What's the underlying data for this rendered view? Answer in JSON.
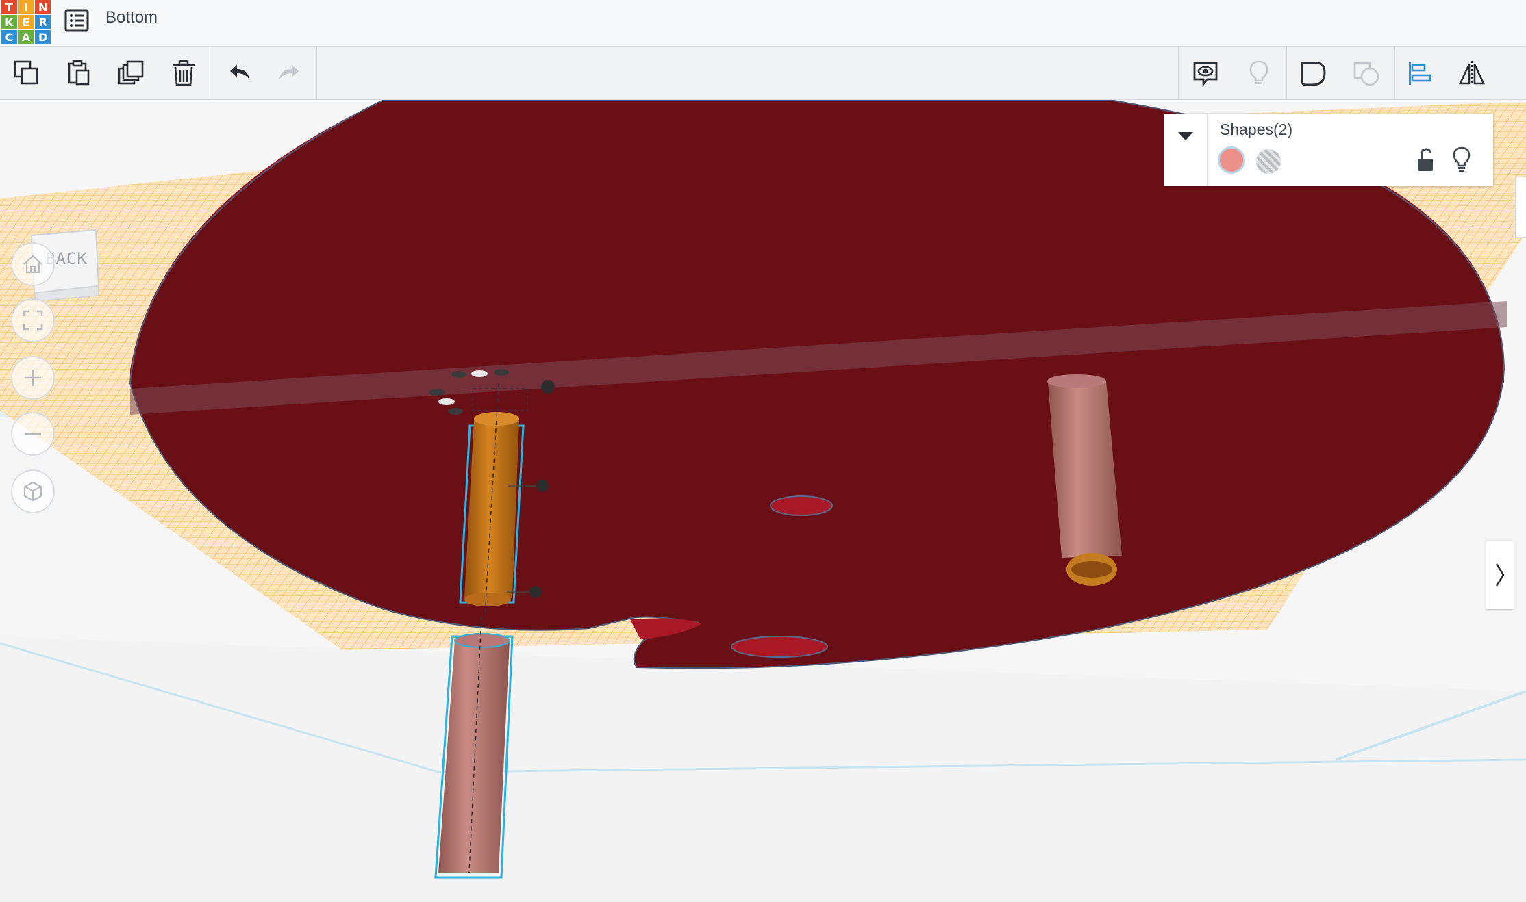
{
  "app": {
    "logo_letters": [
      "T",
      "I",
      "N",
      "K",
      "E",
      "R",
      "C",
      "A",
      "D"
    ],
    "logo_colors": [
      "#e2492f",
      "#f5a623",
      "#e2492f",
      "#69b041",
      "#f5a623",
      "#2f8fd5",
      "#2f8fd5",
      "#69b041",
      "#2f8fd5"
    ],
    "menu_icon": "list-icon",
    "document_title": "Bottom"
  },
  "toolbar": {
    "left": [
      {
        "name": "copy-button",
        "icon": "copy-icon"
      },
      {
        "name": "paste-button",
        "icon": "paste-icon"
      },
      {
        "name": "duplicate-button",
        "icon": "duplicate-icon"
      },
      {
        "name": "delete-button",
        "icon": "trash-icon"
      },
      {
        "name": "undo-button",
        "icon": "undo-icon"
      },
      {
        "name": "redo-button",
        "icon": "redo-icon",
        "disabled": true
      }
    ],
    "right": [
      {
        "name": "notes-button",
        "icon": "speech-eye-icon"
      },
      {
        "name": "show-all-button",
        "icon": "lightbulb-icon",
        "disabled": true
      },
      {
        "name": "group-button",
        "icon": "group-icon"
      },
      {
        "name": "ungroup-button",
        "icon": "ungroup-icon",
        "disabled": true
      },
      {
        "name": "align-button",
        "icon": "align-icon"
      },
      {
        "name": "mirror-button",
        "icon": "mirror-icon"
      }
    ]
  },
  "viewcube": {
    "face_label": "BACK"
  },
  "nav_controls": [
    {
      "name": "home-view-button",
      "icon": "home-icon"
    },
    {
      "name": "fit-view-button",
      "icon": "fit-frame-icon"
    },
    {
      "name": "zoom-in-button",
      "icon": "plus-icon"
    },
    {
      "name": "zoom-out-button",
      "icon": "minus-icon"
    },
    {
      "name": "projection-button",
      "icon": "cube-icon"
    }
  ],
  "shapes_panel": {
    "title": "Shapes(2)",
    "solid_color": "#ec918a",
    "hole_pattern": "striped-gray",
    "lock_icon": "unlock-icon",
    "light_icon": "lightbulb-icon"
  },
  "scene": {
    "disc_color": "#6b0f16",
    "disc_side_color": "#9b1520",
    "grid_color": "#f5b13c",
    "selection_outline": "#29b3e0",
    "peg_color": "#c1827a",
    "selected_peg_color": "#c7771d"
  },
  "panel_toggle_icon": "chevron-right-icon"
}
